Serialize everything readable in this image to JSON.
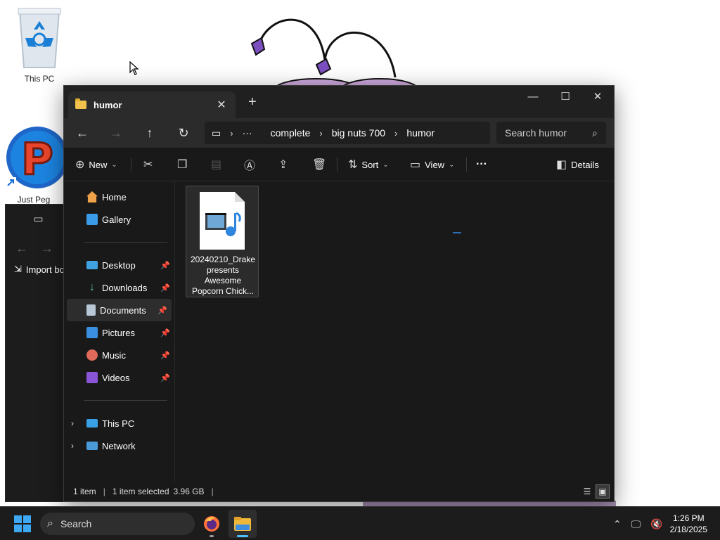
{
  "desktop": {
    "icons": [
      {
        "label": "This PC"
      },
      {
        "label": "Just Peg"
      }
    ]
  },
  "background_window": {
    "import_label": "Import bo"
  },
  "explorer": {
    "tab_title": "humor",
    "breadcrumbs": [
      "complete",
      "big nuts 700",
      "humor"
    ],
    "search_placeholder": "Search humor",
    "toolbar": {
      "new_label": "New",
      "sort_label": "Sort",
      "view_label": "View",
      "more_label": "···",
      "details_label": "Details"
    },
    "nav": {
      "quick": [
        {
          "label": "Home"
        },
        {
          "label": "Gallery"
        }
      ],
      "pinned": [
        {
          "label": "Desktop"
        },
        {
          "label": "Downloads"
        },
        {
          "label": "Documents"
        },
        {
          "label": "Pictures"
        },
        {
          "label": "Music"
        },
        {
          "label": "Videos"
        }
      ],
      "devices": [
        {
          "label": "This PC"
        },
        {
          "label": "Network"
        }
      ]
    },
    "files": [
      {
        "name_lines": [
          "20240210_Drake",
          "presents",
          "Awesome",
          "Popcorn Chick..."
        ]
      }
    ],
    "status": {
      "count": "1 item",
      "selection": "1 item selected",
      "size": "3.96 GB"
    }
  },
  "taskbar": {
    "search_label": "Search",
    "time": "1:26 PM",
    "date": "2/18/2025"
  }
}
